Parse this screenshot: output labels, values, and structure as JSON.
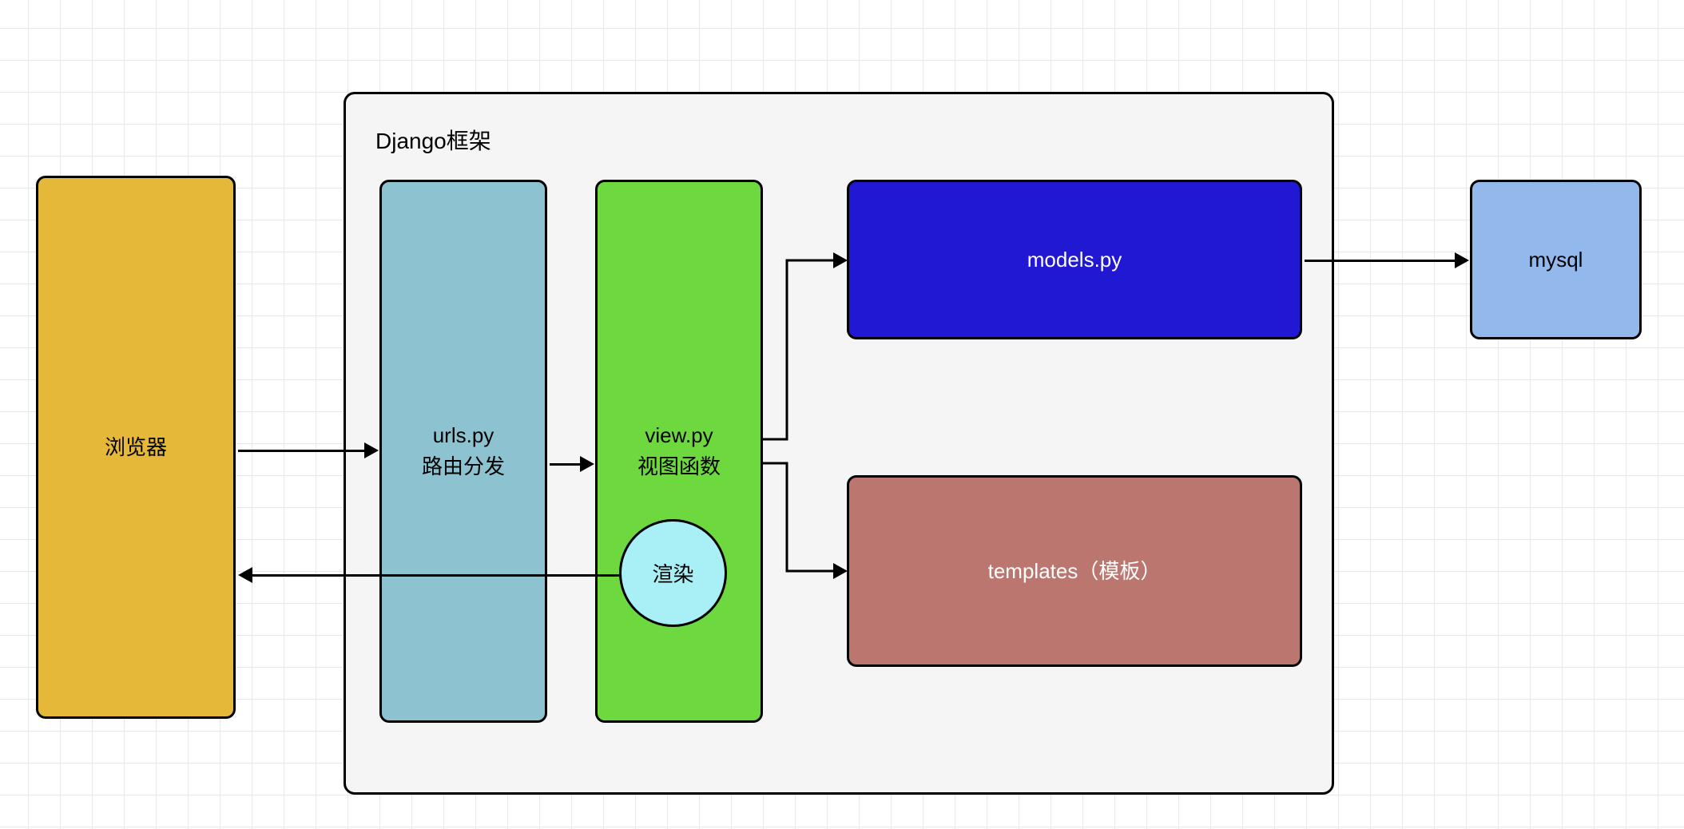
{
  "browser": {
    "label": "浏览器"
  },
  "container": {
    "label": "Django框架"
  },
  "urls": {
    "line1": "urls.py",
    "line2": "路由分发"
  },
  "view": {
    "line1": "view.py",
    "line2": "视图函数"
  },
  "render": {
    "label": "渲染"
  },
  "models": {
    "label": "models.py"
  },
  "templates": {
    "label": "templates（模板）"
  },
  "mysql": {
    "label": "mysql"
  },
  "colors": {
    "browser": "#e6b83a",
    "container": "#f5f5f5",
    "urls": "#8dc2d0",
    "view": "#6ed93f",
    "render": "#a8f0f5",
    "models": "#2118d4",
    "templates": "#bc7670",
    "mysql": "#93b9ec"
  }
}
